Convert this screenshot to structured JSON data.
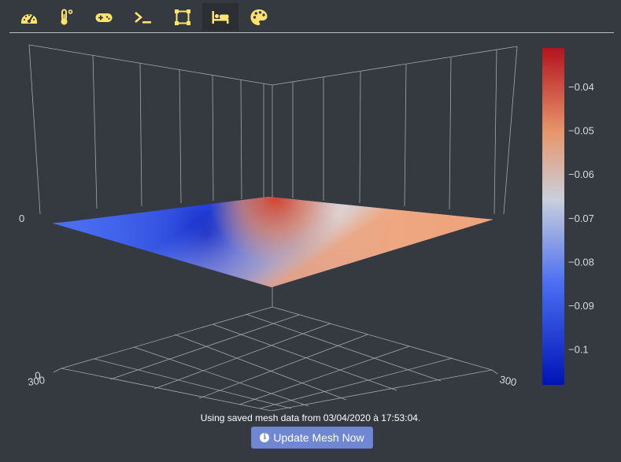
{
  "tabs": [
    {
      "id": "dashboard",
      "icon": "gauge-icon",
      "active": false
    },
    {
      "id": "temperature",
      "icon": "thermometer-icon",
      "active": false
    },
    {
      "id": "control",
      "icon": "gamepad-icon",
      "active": false
    },
    {
      "id": "terminal",
      "icon": "terminal-icon",
      "active": false
    },
    {
      "id": "object",
      "icon": "vector-square-icon",
      "active": false
    },
    {
      "id": "bed",
      "icon": "bed-icon",
      "active": true
    },
    {
      "id": "theme",
      "icon": "palette-icon",
      "active": false
    }
  ],
  "colors": {
    "accent_icon": "#ffe36e",
    "background": "#343a40",
    "button": "#7088d4",
    "colorscale": [
      "#0014b4",
      "#4a6ef2",
      "#c9cfdb",
      "#e8966a",
      "#b2141e"
    ]
  },
  "plot": {
    "axis_tick_labels": {
      "x_corner": "300",
      "y_corner": "300",
      "y_overlap": "0",
      "z_left": "0"
    },
    "colorbar": {
      "ticks": [
        "−0.04",
        "−0.05",
        "−0.06",
        "−0.07",
        "−0.08",
        "−0.09",
        "−0.1"
      ],
      "tick_values": [
        -0.04,
        -0.05,
        -0.06,
        -0.07,
        -0.08,
        -0.09,
        -0.1
      ],
      "range": [
        -0.108,
        -0.031
      ]
    }
  },
  "status": {
    "text": "Using saved mesh data from 03/04/2020 à 17:53:04."
  },
  "update_button": {
    "label": "Update Mesh Now",
    "icon": "info-circle-icon"
  }
}
